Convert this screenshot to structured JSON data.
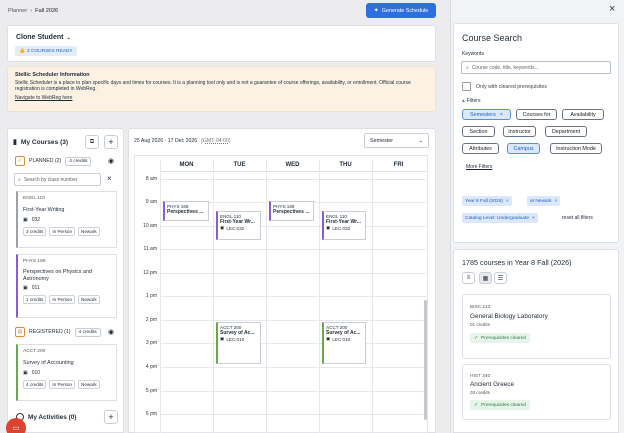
{
  "breadcrumb": {
    "parent": "Planner",
    "current": "Fall 2026"
  },
  "generate_button": "Generate Schedule",
  "student": {
    "name": "Clone Student",
    "ready_badge": "2 COURSES READY"
  },
  "info": {
    "title": "Stellic Scheduler Information",
    "body": "Stellic Scheduler is a place to plan specific days and times for courses. It is a planning tool only and is not a guarantee of course offerings, availability, or enrollment. Official course registration is completed in WebReg.",
    "link": "Navigate to WebReg here"
  },
  "my_courses": {
    "title": "My Courses (3)",
    "planned": {
      "label": "PLANNED (2)",
      "credits": "4 credits"
    },
    "search_placeholder": "Search by class number",
    "planned_items": [
      {
        "code": "ENGL 110",
        "name": "First-Year Writing",
        "section": "032",
        "credits": "3 credits",
        "mode": "In Person",
        "campus": "Newark"
      },
      {
        "code": "PHYS 169",
        "name": "Perspectives on Physics and Astronomy",
        "section": "011",
        "credits": "1 credits",
        "mode": "In Person",
        "campus": "Newark"
      }
    ],
    "registered": {
      "label": "REGISTERED (1)",
      "credits": "4 credits"
    },
    "registered_items": [
      {
        "code": "ACCT 200",
        "name": "Survey of Accounting",
        "section": "010",
        "credits": "4 credits",
        "mode": "In Person",
        "campus": "Newark"
      }
    ],
    "activities": "My Activities (0)"
  },
  "calendar": {
    "range": "25 Aug 2026 - 17 Dec 2026",
    "tz": "(GMT-04:00)",
    "view": "Semester",
    "days": [
      "MON",
      "TUE",
      "WED",
      "THU",
      "FRI"
    ],
    "times": [
      "8 am",
      "9 am",
      "10 am",
      "11 am",
      "12 pm",
      "1 pm",
      "2 pm",
      "3 pm",
      "4 pm",
      "5 pm",
      "6 pm"
    ],
    "events": [
      {
        "code": "PHYS 169",
        "title": "Perspectives ...",
        "loc": ""
      },
      {
        "code": "ENGL 110",
        "title": "First-Year Wr...",
        "loc": "LEC:032"
      },
      {
        "code": "PHYS 169",
        "title": "Perspectives ...",
        "loc": ""
      },
      {
        "code": "ENGL 110",
        "title": "First-Year Wr...",
        "loc": "LEC:032"
      },
      {
        "code": "ACCT 200",
        "title": "Survey of Ac...",
        "loc": "LEC:010"
      },
      {
        "code": "ACCT 200",
        "title": "Survey of Ac...",
        "loc": "LEC:010"
      }
    ]
  },
  "search": {
    "title": "Course Search",
    "keywords_label": "Keywords",
    "keywords_placeholder": "Course code, title, keywords...",
    "cleared_only": "Only with cleared prerequisites",
    "filters_label": "Filters",
    "filter_chips": [
      "Semesters",
      "Courses for",
      "Availability",
      "Section",
      "Instructor",
      "Department",
      "Attributes",
      "Campus",
      "Instruction Mode"
    ],
    "more_filters": "More Filters",
    "active_filters": [
      "Year 8 Fall (2026)",
      "at Newark",
      "Catalog Level: Undergraduate"
    ],
    "reset": "reset all filters",
    "results_count": "1785 courses in Year 8 Fall (2026)",
    "results": [
      {
        "code": "BISC 113",
        "name": "General Biology Laboratory",
        "credits": "01 credits",
        "status": "Prerequisites cleared"
      },
      {
        "code": "HIST 340",
        "name": "Ancient Greece",
        "credits": "03 credits",
        "status": "Prerequisites cleared"
      }
    ]
  }
}
